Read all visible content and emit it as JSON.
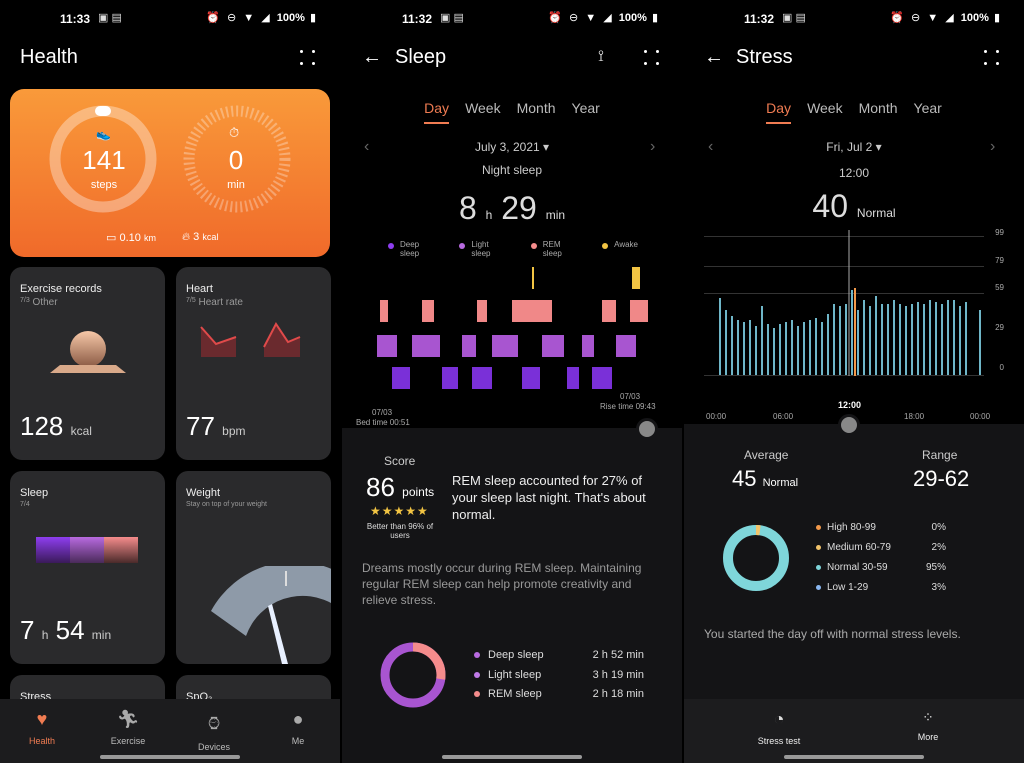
{
  "p1": {
    "time": "11:33",
    "battery": "100%",
    "title": "Health",
    "steps_value": "141",
    "steps_unit": "steps",
    "min_value": "0",
    "min_unit": "min",
    "distance": "0.10",
    "distance_unit": "km",
    "kcal": "3",
    "kcal_unit": "kcal",
    "exercise": {
      "title": "Exercise records",
      "date": "7/3",
      "sub": "Other",
      "value": "128",
      "unit": "kcal"
    },
    "heart": {
      "title": "Heart",
      "date": "7/5",
      "sub": "Heart rate",
      "value": "77",
      "unit": "bpm"
    },
    "sleep": {
      "title": "Sleep",
      "date": "7/4",
      "h": "7",
      "h_unit": "h",
      "m": "54",
      "m_unit": "min"
    },
    "weight": {
      "title": "Weight",
      "sub": "Stay on top of your weight"
    },
    "stress_title": "Stress",
    "spo2_title": "SpO₂",
    "nav": [
      "Health",
      "Exercise",
      "Devices",
      "Me"
    ],
    "accent": "#f07c52"
  },
  "p2": {
    "time": "11:32",
    "battery": "100%",
    "title": "Sleep",
    "tabs": [
      "Day",
      "Week",
      "Month",
      "Year"
    ],
    "date": "July 3, 2021",
    "section": "Night sleep",
    "hours": "8",
    "h_unit": "h",
    "minutes": "29",
    "m_unit": "min",
    "legend": [
      {
        "label": "Deep\nsleep",
        "color": "#8e3ef0"
      },
      {
        "label": "Light\nsleep",
        "color": "#b86ae0"
      },
      {
        "label": "REM\nsleep",
        "color": "#f58c8c"
      },
      {
        "label": "Awake",
        "color": "#f2c443"
      }
    ],
    "bed_date": "07/03",
    "bed_time": "Bed time 00:51",
    "rise_date": "07/03",
    "rise_time": "Rise time 09:43",
    "score_label": "Score",
    "score": "86",
    "score_unit": "points",
    "stars": "★★★★★",
    "better": "Better than 96% of users",
    "rem_text": "REM sleep accounted for 27% of your sleep last night. That's about normal.",
    "dream_text": "Dreams mostly occur during REM sleep. Maintaining regular REM sleep can help promote creativity and relieve stress.",
    "breakdown": [
      {
        "label": "Deep sleep",
        "value": "2 h 52 min",
        "color": "#b86ae0"
      },
      {
        "label": "Light sleep",
        "value": "3 h 19 min",
        "color": "#c07ae8"
      },
      {
        "label": "REM sleep",
        "value": "2 h 18 min",
        "color": "#f58c8c"
      }
    ]
  },
  "p3": {
    "time": "11:32",
    "battery": "100%",
    "title": "Stress",
    "tabs": [
      "Day",
      "Week",
      "Month",
      "Year"
    ],
    "date": "Fri, Jul 2",
    "sel_time": "12:00",
    "sel_value": "40",
    "sel_level": "Normal",
    "yticks": [
      "99",
      "79",
      "59",
      "29",
      "0"
    ],
    "xticks": [
      "00:00",
      "06:00",
      "12:00",
      "18:00",
      "00:00"
    ],
    "avg_label": "Average",
    "avg_value": "45",
    "avg_level": "Normal",
    "range_label": "Range",
    "range_value": "29-62",
    "levels": [
      {
        "label": "High 80-99",
        "pct": "0%",
        "color": "#f2994a"
      },
      {
        "label": "Medium 60-79",
        "pct": "2%",
        "color": "#f2c46b"
      },
      {
        "label": "Normal 30-59",
        "pct": "95%",
        "color": "#7fd6da"
      },
      {
        "label": "Low 1-29",
        "pct": "3%",
        "color": "#8ab7f0"
      }
    ],
    "summary": "You started the day off with normal stress levels.",
    "stress_test": "Stress test",
    "more": "More"
  }
}
